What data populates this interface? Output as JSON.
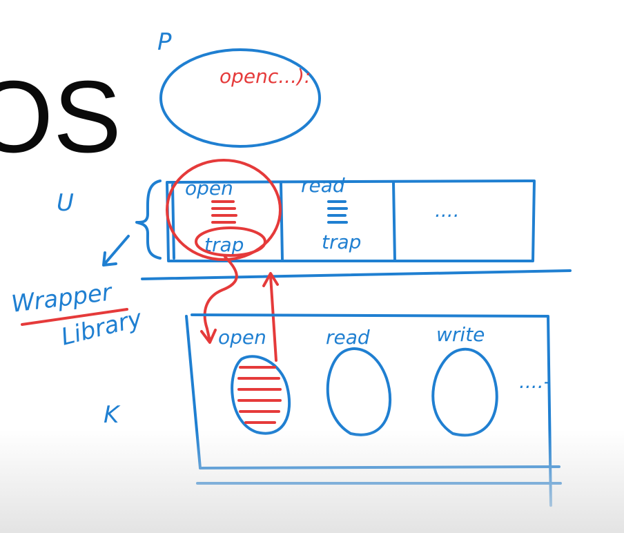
{
  "slide": {
    "title_fragment": "OS"
  },
  "diagram": {
    "process_label": "P",
    "process_call": "openc...):",
    "user_label": "U",
    "kernel_label": "K",
    "wrapper_label": "Wrapper",
    "library_label": "Library",
    "user_cells": [
      {
        "name": "open",
        "body": "trap"
      },
      {
        "name": "read",
        "body": "trap"
      },
      {
        "name": "....",
        "body": ""
      }
    ],
    "kernel_cells": [
      "open",
      "read",
      "write"
    ],
    "kernel_more": "....-"
  },
  "colors": {
    "pen_blue": "#1f7fd1",
    "pen_red": "#e53a3a",
    "title_black": "#0a0a0a"
  }
}
